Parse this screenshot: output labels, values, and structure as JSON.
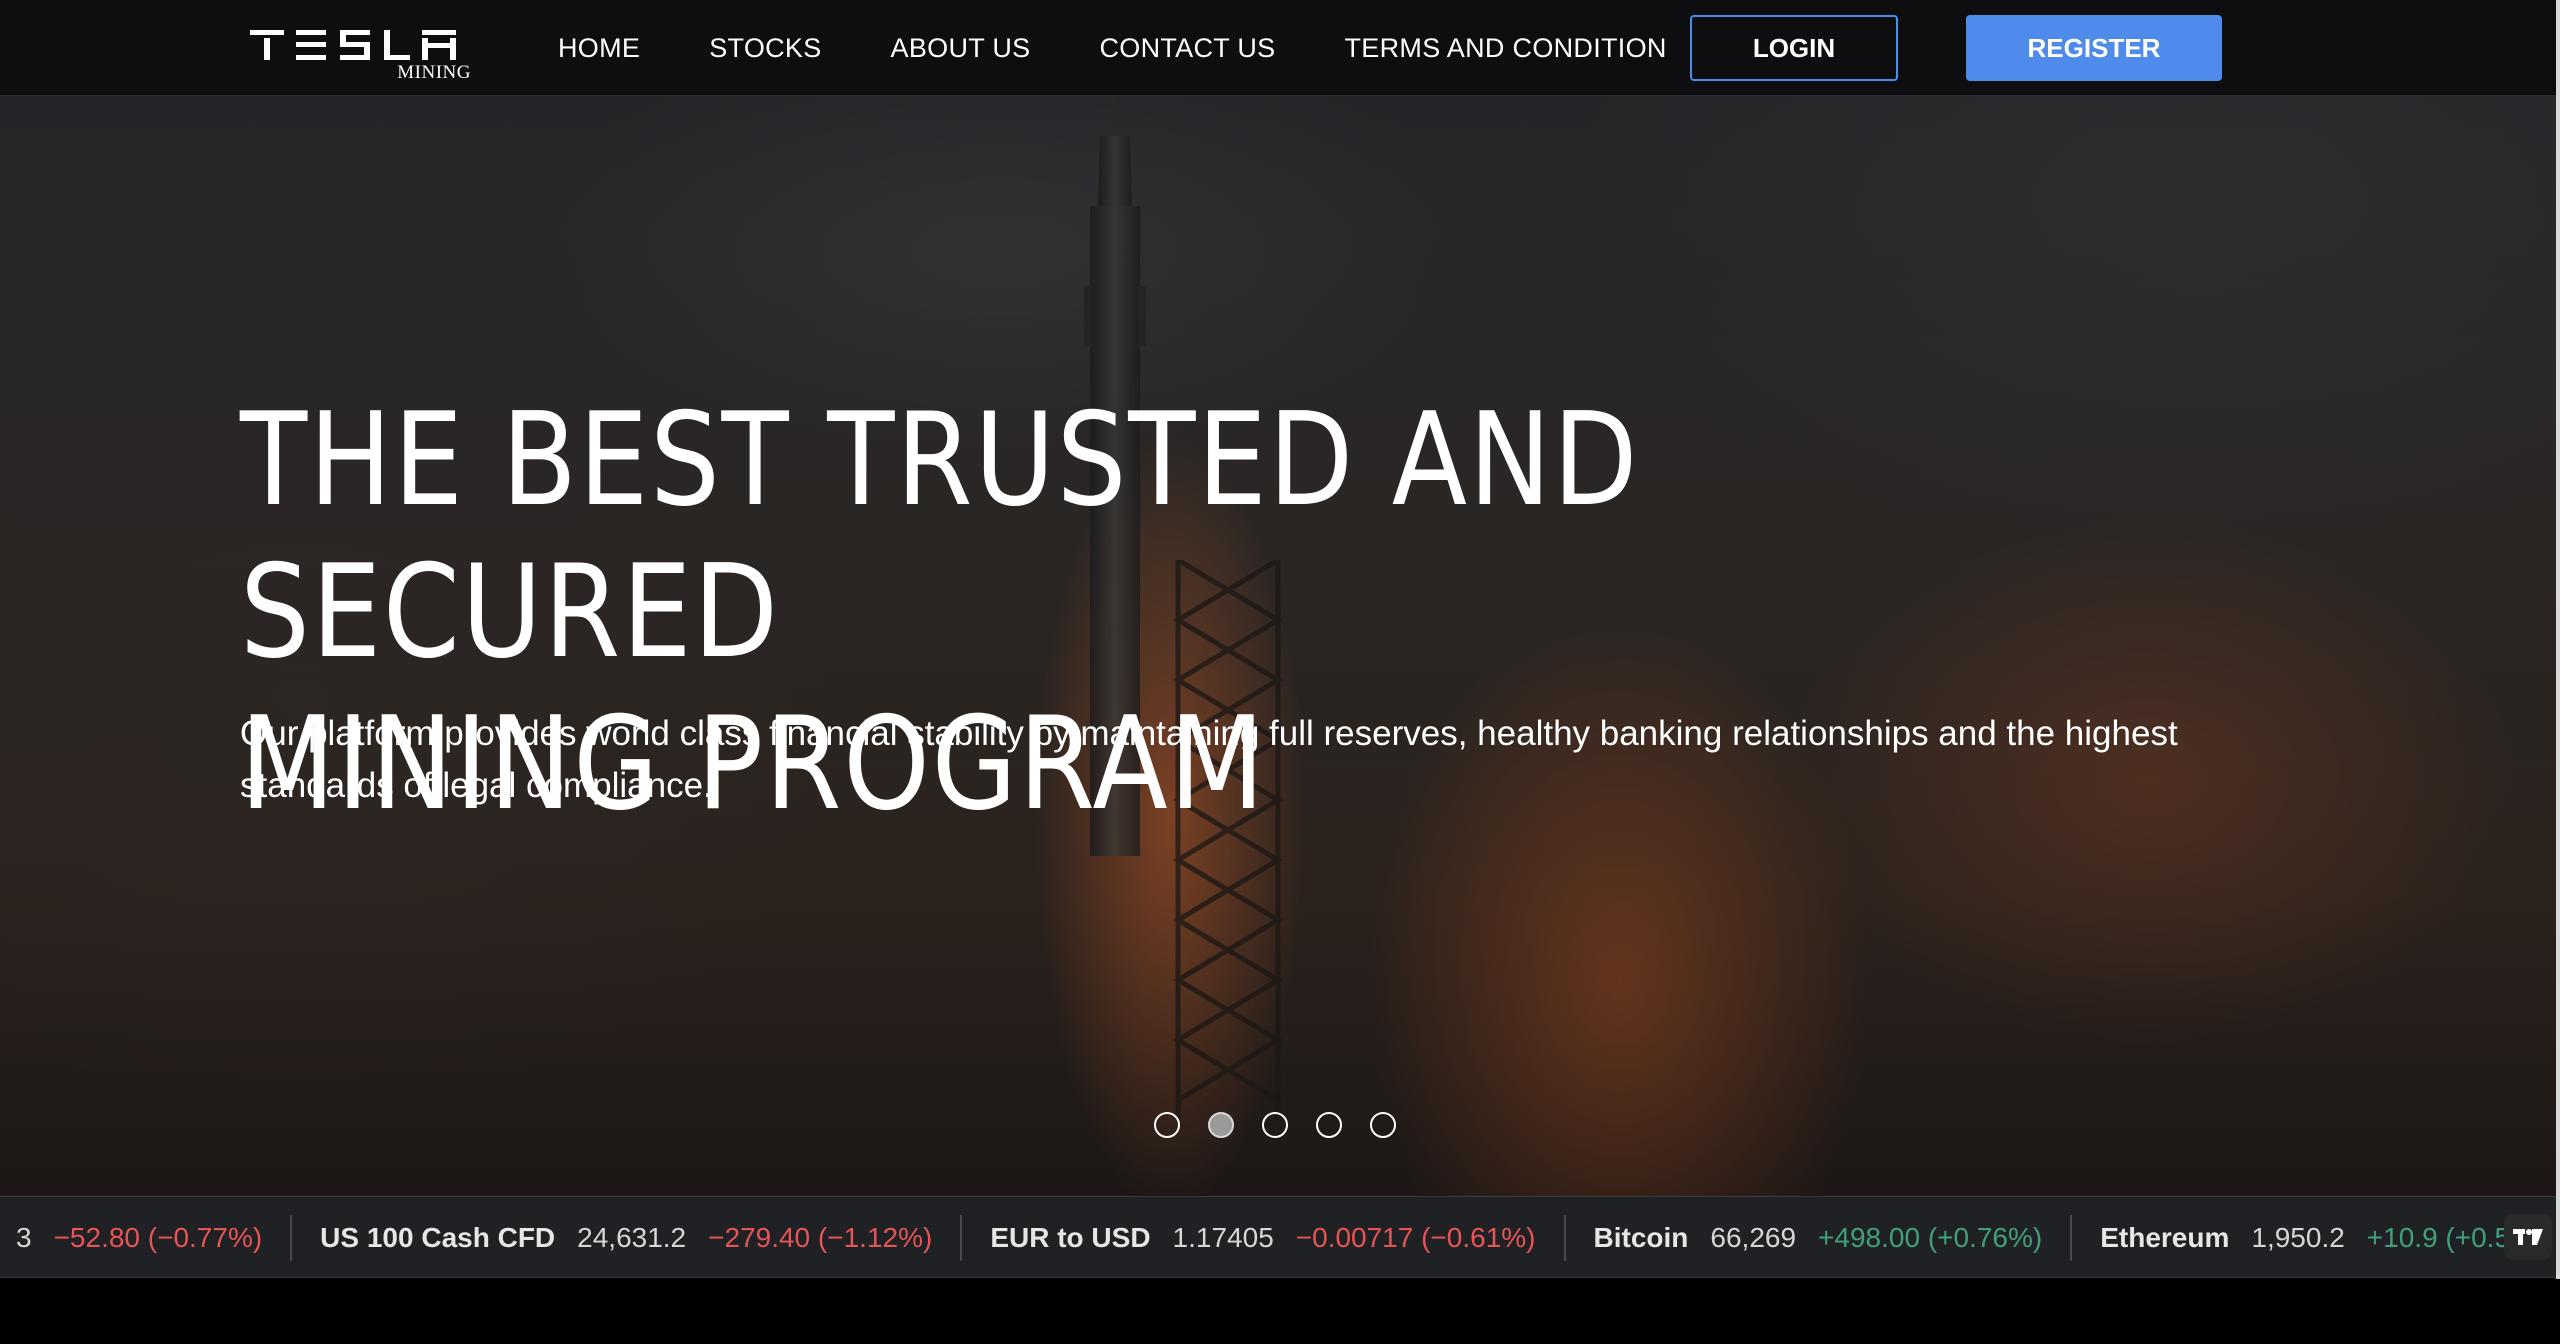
{
  "brand": {
    "name": "TESLA",
    "sub": "MINING"
  },
  "nav": {
    "links": [
      "HOME",
      "STOCKS",
      "ABOUT US",
      "CONTACT US",
      "TERMS AND CONDITION"
    ],
    "login_label": "LOGIN",
    "register_label": "REGISTER",
    "accent": "#4f8bea"
  },
  "hero": {
    "title_line1": "THE BEST TRUSTED AND SECURED",
    "title_line2": "MINING PROGRAM",
    "subtitle": "Our platform provides world class financial stability by maintaining full reserves, healthy banking relationships and the highest standards of legal compliance.",
    "slides": 5,
    "active_slide": 2
  },
  "ticker": {
    "items": [
      {
        "name": "",
        "price": "3",
        "change": "−52.80 (−0.77%)",
        "direction": "down"
      },
      {
        "name": "US 100 Cash CFD",
        "price": "24,631.2",
        "change": "−279.40 (−1.12%)",
        "direction": "down"
      },
      {
        "name": "EUR to USD",
        "price": "1.17405",
        "change": "−0.00717 (−0.61%)",
        "direction": "down"
      },
      {
        "name": "Bitcoin",
        "price": "66,269",
        "change": "+498.00 (+0.76%)",
        "direction": "up"
      },
      {
        "name": "Ethereum",
        "price": "1,950.2",
        "change": "+10.9 (+0.5",
        "direction": "up"
      }
    ],
    "colors": {
      "down": "#e65555",
      "up": "#3fa07a"
    },
    "widget_icon": "tradingview-icon"
  }
}
